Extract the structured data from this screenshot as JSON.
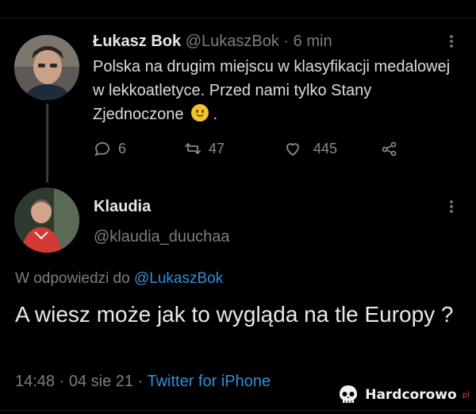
{
  "tweet": {
    "author_name": "Łukasz Bok",
    "author_handle": "@LukaszBok",
    "separator": "·",
    "time_ago": "6 min",
    "text": "Polska na drugim miejscu w klasyfikacji medalowej w lekkoatletyce. Przed nami tylko Stany Zjednoczone",
    "emoji_after": ".",
    "replies": "6",
    "retweets": "47",
    "likes": "445",
    "icons": [
      "comment-icon",
      "retweet-icon",
      "heart-icon",
      "share-icon",
      "more-icon"
    ]
  },
  "reply": {
    "author_name": "Klaudia",
    "author_handle": "@klaudia_duuchaa",
    "replying_prefix": "W odpowiedzi do",
    "replying_to": "@LukaszBok",
    "text": "A wiesz może jak to wygląda na tle Europy ?",
    "time": "14:48",
    "date": "04 sie 21",
    "separator": "·",
    "source": "Twitter for iPhone"
  },
  "watermark": {
    "text": "Hardcorowo",
    "suffix": ".pl"
  },
  "colors": {
    "background": "#000000",
    "link": "#2f8fd8",
    "muted": "#7d7d7d",
    "text": "#dcdcdc"
  }
}
